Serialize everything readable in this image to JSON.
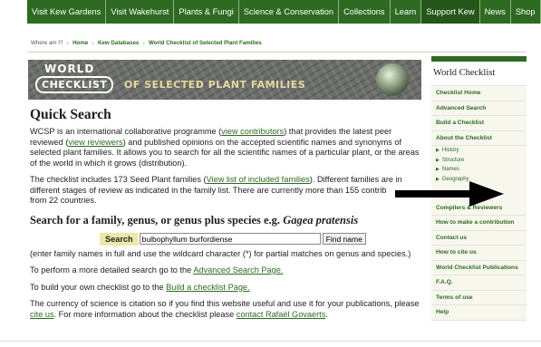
{
  "topnav": {
    "items": [
      "Visit Kew Gardens",
      "Visit Wakehurst",
      "Plants & Fungi",
      "Science & Conservation",
      "Collections",
      "Learn",
      "Support Kew",
      "News",
      "Shop"
    ]
  },
  "breadcrumb": {
    "label": "Where am I?",
    "items": [
      "Home",
      "Kew Databases",
      "World Checklist of Selected Plant Families"
    ]
  },
  "banner": {
    "line1": "WORLD",
    "line2": "CHECKLIST",
    "line3": "OF SELECTED PLANT FAMILIES"
  },
  "main": {
    "title": "Quick Search",
    "intro": {
      "t1": "WCSP is an international collaborative programme (",
      "l1": "view contributors",
      "t2": ") that provides the latest peer reviewed (",
      "l2": "view reviewers",
      "t3": ") and published opinions on the accepted scientific names and synonyms of selected plant families. It allows you to search for all the scientific names of a particular plant, or the areas of the world in which it grows (distribution)."
    },
    "families": {
      "t1": "The checklist includes 173 Seed Plant families (",
      "l1": "View list of included families",
      "t2": "). Different families are in different stages of review as indicated in the family list. There are currently more than 155 contrib",
      "t3": "from 22 countries."
    },
    "search_heading": "Search for a family, genus, or genus plus species e.g.",
    "search_example": "Gagea pratensis",
    "search_label": "Search",
    "search_value": "bulbophyllum burfordiense",
    "find_label": "Find name",
    "hint": "(enter family names in full and use the wildcard character (*) for partial matches on genus and species.)",
    "advanced": {
      "t1": "To perform a more detailed search go to the ",
      "l1": "Advanced Search Page."
    },
    "build": {
      "t1": "To build your own checklist go to the ",
      "l1": "Build a checklist Page."
    },
    "citation": {
      "t1": "The currency of science is citation so if you find this website useful and use it for your publications, please ",
      "l1": "cite us",
      "t2": ". For more information about the checklist please ",
      "l2": "contact Rafaël Govaerts",
      "t3": "."
    }
  },
  "sidebar": {
    "title": "World Checklist",
    "items": [
      "Checklist Home",
      "Advanced Search",
      "Build a Checklist",
      "About the Checklist"
    ],
    "subitems": [
      "History",
      "Structure",
      "Names",
      "Geography",
      "Abbreviati"
    ],
    "items2": [
      "Compilers & Reviewers",
      "How to make a contribution",
      "Contact us",
      "How to cite us",
      "World Checklist Publications",
      "F.A.Q.",
      "Terms of use",
      "Help"
    ]
  },
  "colors": {
    "kew_green": "#2e6a22",
    "search_highlight": "#ece9a6"
  }
}
